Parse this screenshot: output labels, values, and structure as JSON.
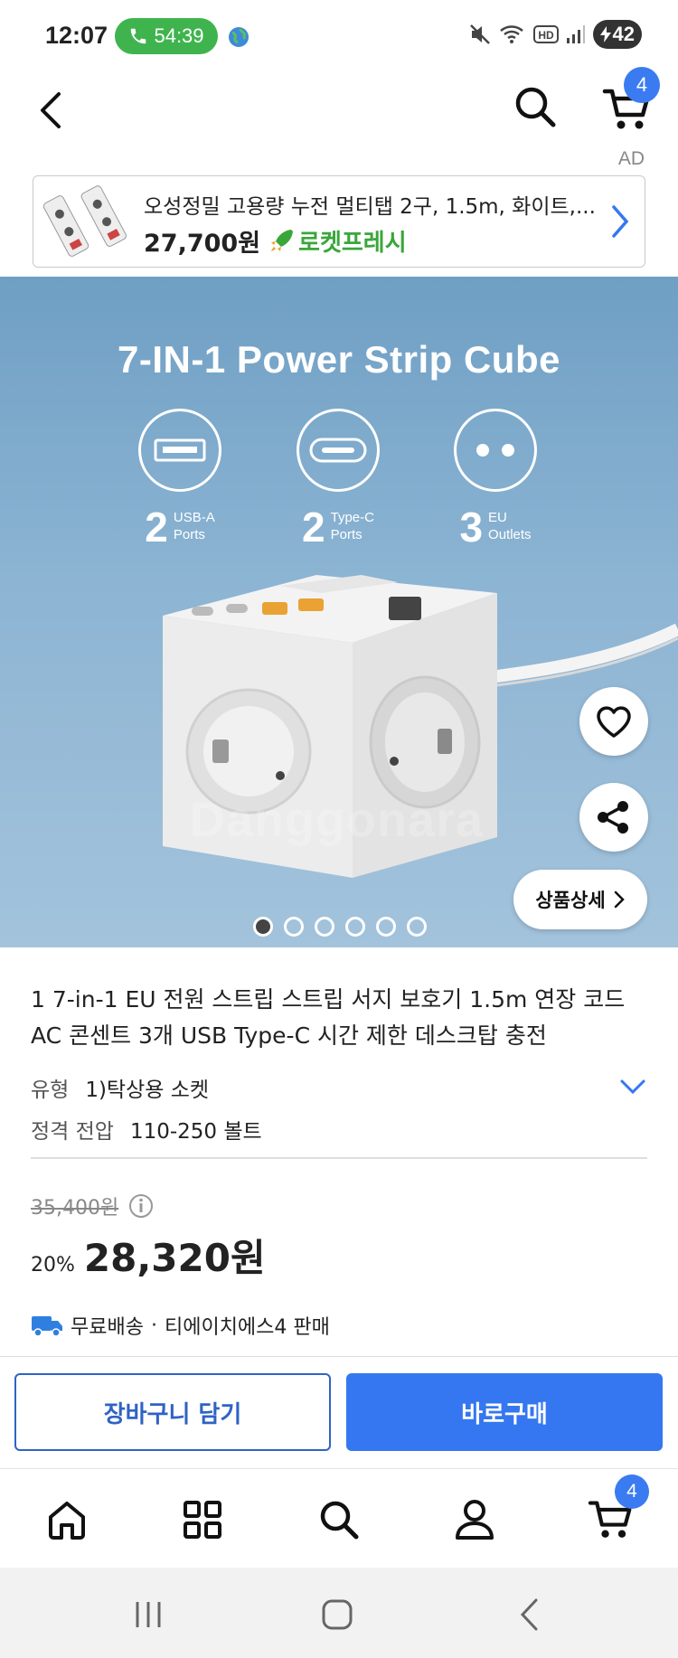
{
  "status_bar": {
    "time": "12:07",
    "call_timer": "54:39",
    "battery_level": "42"
  },
  "header": {
    "cart_count": "4",
    "ad_label": "AD"
  },
  "ad_banner": {
    "title": "오성정밀 고용량 누전 멀티탭 2구, 1.5m, 화이트,...",
    "price": "27,700원",
    "badge": "로켓프레시"
  },
  "hero": {
    "title": "7-IN-1 Power Strip Cube",
    "features": [
      {
        "count": "2",
        "line1": "USB-A",
        "line2": "Ports",
        "icon": "usb-a-port-icon"
      },
      {
        "count": "2",
        "line1": "Type-C",
        "line2": "Ports",
        "icon": "usb-c-port-icon"
      },
      {
        "count": "3",
        "line1": "EU",
        "line2": "Outlets",
        "icon": "eu-outlet-icon"
      }
    ],
    "watermark": "Danggonara",
    "detail_button": "상품상세",
    "image_count": 6,
    "active_image": 1
  },
  "product": {
    "title": "1 7-in-1 EU 전원 스트립 스트립 서지 보호기 1.5m 연장 코드 AC 콘센트 3개 USB Type-C 시간 제한 데스크탑 충전",
    "option_type_label": "유형",
    "option_type_value": "1)탁상용 소켓",
    "voltage_label": "정격 전압",
    "voltage_value": "110-250 볼트",
    "original_price": "35,400원",
    "discount": "20%",
    "sale_price": "28,320원",
    "shipping": "무료배송",
    "seller": "티에이치에스4 판매"
  },
  "actions": {
    "add_to_cart": "장바구니 담기",
    "buy_now": "바로구매"
  },
  "bottom_nav": {
    "cart_count": "4"
  },
  "colors": {
    "accent": "#3577f0",
    "call_green": "#3fb44e",
    "rocket_green": "#3aa63a"
  }
}
